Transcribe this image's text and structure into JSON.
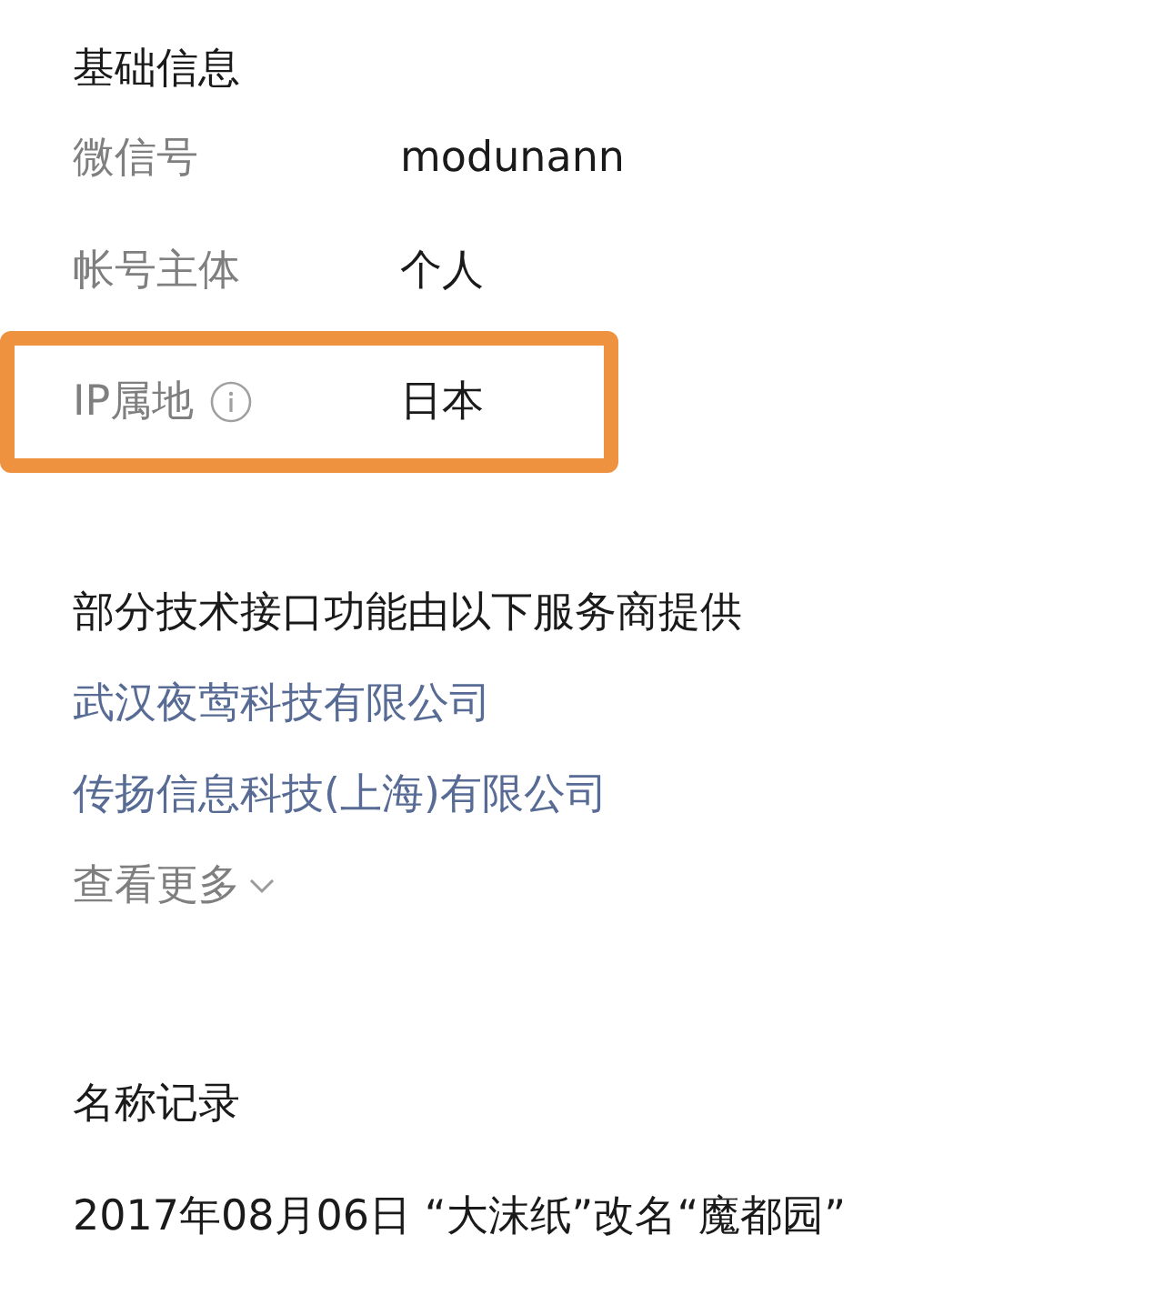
{
  "basic_info": {
    "title": "基础信息",
    "rows": [
      {
        "label": "微信号",
        "value": "modunann",
        "highlighted": false,
        "info_icon": false
      },
      {
        "label": "帐号主体",
        "value": "个人",
        "highlighted": false,
        "info_icon": false
      },
      {
        "label": "IP属地",
        "value": "日本",
        "highlighted": true,
        "info_icon": true
      }
    ]
  },
  "providers": {
    "title": "部分技术接口功能由以下服务商提供",
    "links": [
      "武汉夜莺科技有限公司",
      "传扬信息科技(上海)有限公司"
    ],
    "more": "查看更多"
  },
  "name_history": {
    "title": "名称记录",
    "entries": [
      "2017年08月06日 “大沫纸”改名“魔都园”"
    ]
  }
}
